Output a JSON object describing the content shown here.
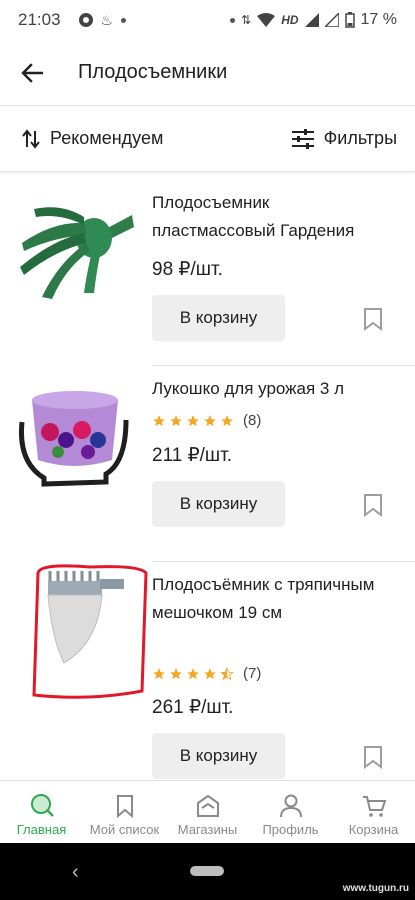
{
  "status_bar": {
    "time": "21:03",
    "network": "HD",
    "battery": "17 %"
  },
  "app_bar": {
    "title": "Плодосъемники"
  },
  "toolbar": {
    "sort_label": "Рекомендуем",
    "filter_label": "Фильтры"
  },
  "products": [
    {
      "name": "Плодосъемник пластмассовый Гардения",
      "price": "98 ₽/шт.",
      "cart_label": "В корзину",
      "rating": null,
      "reviews": null
    },
    {
      "name": "Лукошко для урожая 3 л",
      "price": "211 ₽/шт.",
      "cart_label": "В корзину",
      "rating": 5,
      "reviews": "(8)"
    },
    {
      "name": "Плодосъёмник с тряпичным мешочком 19 см",
      "price": "261 ₽/шт.",
      "cart_label": "В корзину",
      "rating": 4.5,
      "reviews": "(7)"
    }
  ],
  "bottom_nav": [
    {
      "label": "Главная",
      "icon": "search-icon",
      "active": true
    },
    {
      "label": "Мой список",
      "icon": "bookmark-icon",
      "active": false
    },
    {
      "label": "Магазины",
      "icon": "store-icon",
      "active": false
    },
    {
      "label": "Профиль",
      "icon": "person-icon",
      "active": false
    },
    {
      "label": "Корзина",
      "icon": "cart-icon",
      "active": false
    }
  ],
  "colors": {
    "accent": "#2fa84f",
    "star": "#f5a623",
    "button_bg": "#eeeeee",
    "highlight": "#e0182a"
  },
  "watermark": "www.tugun.ru"
}
